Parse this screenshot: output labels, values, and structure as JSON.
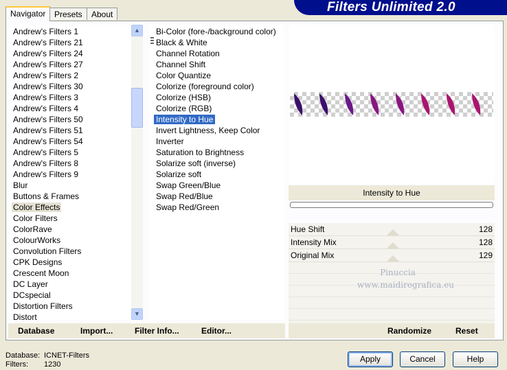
{
  "app": {
    "title": "Filters Unlimited 2.0"
  },
  "tabs": [
    "Navigator",
    "Presets",
    "About"
  ],
  "categories": [
    "Andrew's Filters 1",
    "Andrew's Filters 21",
    "Andrew's Filters 24",
    "Andrew's Filters 27",
    "Andrew's Filters 2",
    "Andrew's Filters 30",
    "Andrew's Filters 3",
    "Andrew's Filters 4",
    "Andrew's Filters 50",
    "Andrew's Filters 51",
    "Andrew's Filters 54",
    "Andrew's Filters 5",
    "Andrew's Filters 8",
    "Andrew's Filters 9",
    "Blur",
    "Buttons & Frames",
    "Color Effects",
    "Color Filters",
    "ColorRave",
    "ColourWorks",
    "Convolution Filters",
    "CPK Designs",
    "Crescent Moon",
    "DC Layer",
    "DCspecial",
    "Distortion Filters",
    "Distort"
  ],
  "selected_category": "Color Effects",
  "filters": [
    "Bi-Color (fore-/background color)",
    "Black & White",
    "Channel Rotation",
    "Channel Shift",
    "Color Quantize",
    "Colorize (foreground color)",
    "Colorize (HSB)",
    "Colorize (RGB)",
    "Intensity to Hue",
    "Invert Lightness, Keep Color",
    "Inverter",
    "Saturation to Brightness",
    "Solarize soft (inverse)",
    "Solarize soft",
    "Swap Green/Blue",
    "Swap Red/Blue",
    "Swap Red/Green"
  ],
  "selected_filter": "Intensity to Hue",
  "preview": {
    "leaf_colors": [
      "#3d0f6b",
      "#3d0f6b",
      "#6a1a8a",
      "#8a1680",
      "#8a1680",
      "#a8156e",
      "#a8156e",
      "#a8156e"
    ]
  },
  "filter_name": "Intensity to Hue",
  "params": [
    {
      "label": "Hue Shift",
      "value": "128"
    },
    {
      "label": "Intensity Mix",
      "value": "128"
    },
    {
      "label": "Original Mix",
      "value": "129"
    }
  ],
  "watermark": {
    "line1": "Pinuccia",
    "line2": "www.maidiregrafica.eu"
  },
  "toolbar": {
    "database": "Database",
    "import": "Import...",
    "filter_info": "Filter Info...",
    "editor": "Editor...",
    "randomize": "Randomize",
    "reset": "Reset"
  },
  "status": {
    "database_label": "Database:",
    "database_value": "ICNET-Filters",
    "filters_label": "Filters:",
    "filters_value": "1230"
  },
  "buttons": {
    "apply": "Apply",
    "cancel": "Cancel",
    "help": "Help"
  },
  "colors": {
    "banner": "#000f8c",
    "selection": "#316ac5",
    "tab_highlight": "#ffc83c"
  }
}
